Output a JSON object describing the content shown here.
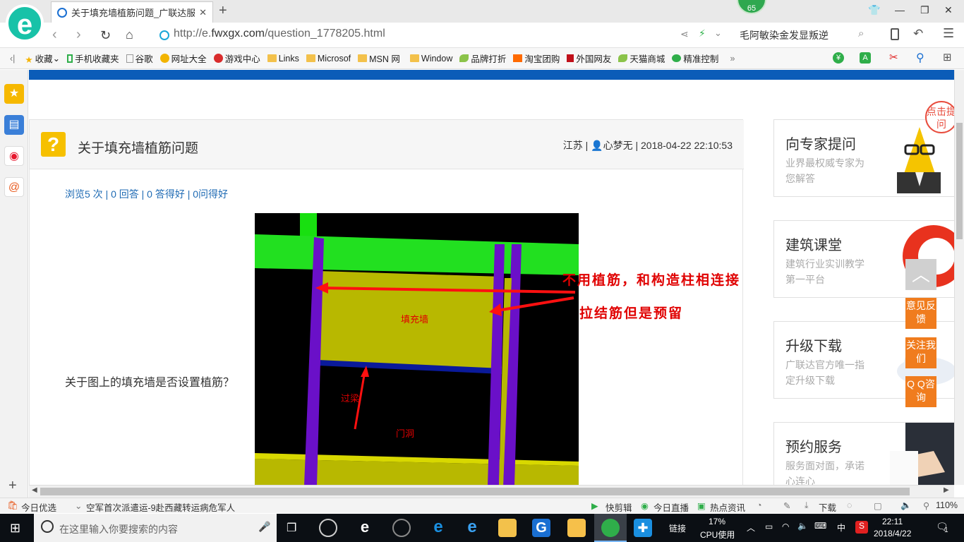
{
  "browser": {
    "tab_title": "关于填充墙植筋问题_广联达服务",
    "badge": "65",
    "url_scheme": "http://e.",
    "url_domain": "fwxgx.com",
    "url_path": "/question_1778205.html",
    "search_text": "毛阿敏染金发显叛逆"
  },
  "bookmarks": [
    "收藏",
    "手机收藏夹",
    "谷歌",
    "网址大全",
    "游戏中心",
    "Links",
    "Microsof",
    "MSN 网",
    "Window",
    "品牌打折",
    "淘宝团购",
    "外国网友",
    "天猫商城",
    "精准控制",
    "»"
  ],
  "question": {
    "title": "关于填充墙植筋问题",
    "region": "江苏",
    "user": "心梦无",
    "datetime": "2018-04-22 22:10:53",
    "stats": "浏览5 次 | 0 回答 | 0 答得好 | 0问得好",
    "body": "关于图上的填充墙是否设置植筋？"
  },
  "image_labels": {
    "wall": "填充墙",
    "beam": "过梁",
    "door": "门洞",
    "anno1": "不用植筋，和构造柱相连接",
    "anno2": "拉结筋但是预留"
  },
  "cards": [
    {
      "title": "向专家提问",
      "desc": "业界最权威专家为您解答"
    },
    {
      "title": "建筑课堂",
      "desc": "建筑行业实训教学第一平台"
    },
    {
      "title": "升级下载",
      "desc": "广联达官方唯一指定升级下载"
    },
    {
      "title": "预约服务",
      "desc": "服务面对面，承诺心连心"
    }
  ],
  "bubble_text": "点击提问",
  "float_buttons": [
    "意见反馈",
    "关注我们",
    "Q Q咨询"
  ],
  "statusbar": {
    "left": "今日优选",
    "news": "空军首次派遣运-9赴西藏转运病危军人",
    "items": [
      "快剪辑",
      "今日直播",
      "热点资讯",
      "下载"
    ],
    "zoom": "110%"
  },
  "taskbar": {
    "search_placeholder": "在这里输入你要搜索的内容",
    "link": "链接",
    "cpu_percent": "17%",
    "cpu_label": "CPU使用",
    "ime": "中",
    "time": "22:11",
    "date": "2018/4/22",
    "notifications": "1"
  }
}
